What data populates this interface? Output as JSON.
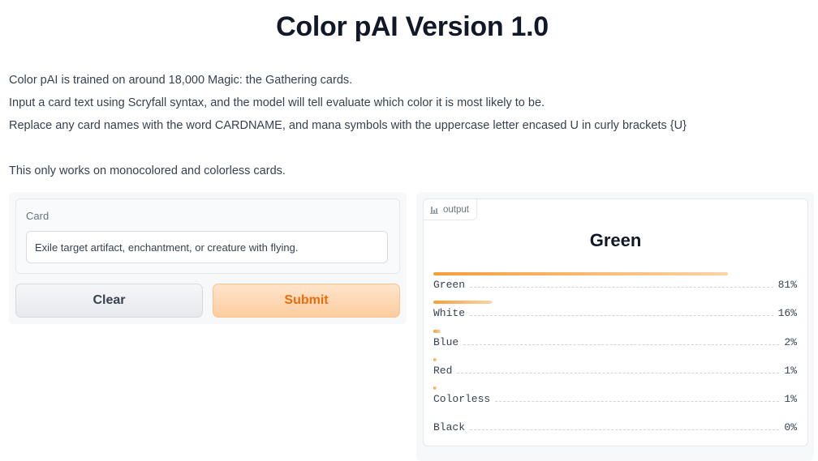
{
  "page": {
    "title": "Color pAI Version 1.0",
    "description": [
      "Color pAI is trained on around 18,000 Magic: the Gathering cards.",
      "Input a card text using Scryfall syntax, and the model will tell evaluate which color it is most likely to be.",
      "Replace any card names with the word CARDNAME, and mana symbols with the uppercase letter encased U in curly brackets {U}",
      "This only works on monocolored and colorless cards."
    ]
  },
  "input": {
    "label": "Card",
    "value": "Exile target artifact, enchantment, or creature with flying."
  },
  "buttons": {
    "clear": "Clear",
    "submit": "Submit"
  },
  "output": {
    "tag_label": "output",
    "tag_icon": "bar-chart-icon",
    "top_label": "Green",
    "confidences": [
      {
        "label": "Green",
        "percent_text": "81%",
        "value": 0.81
      },
      {
        "label": "White",
        "percent_text": "16%",
        "value": 0.16
      },
      {
        "label": "Blue",
        "percent_text": "2%",
        "value": 0.02
      },
      {
        "label": "Red",
        "percent_text": "1%",
        "value": 0.01
      },
      {
        "label": "Colorless",
        "percent_text": "1%",
        "value": 0.01
      },
      {
        "label": "Black",
        "percent_text": "0%",
        "value": 0.0
      }
    ]
  },
  "colors": {
    "accent": "#f59e3b",
    "submit_text": "#ea6d0a"
  }
}
